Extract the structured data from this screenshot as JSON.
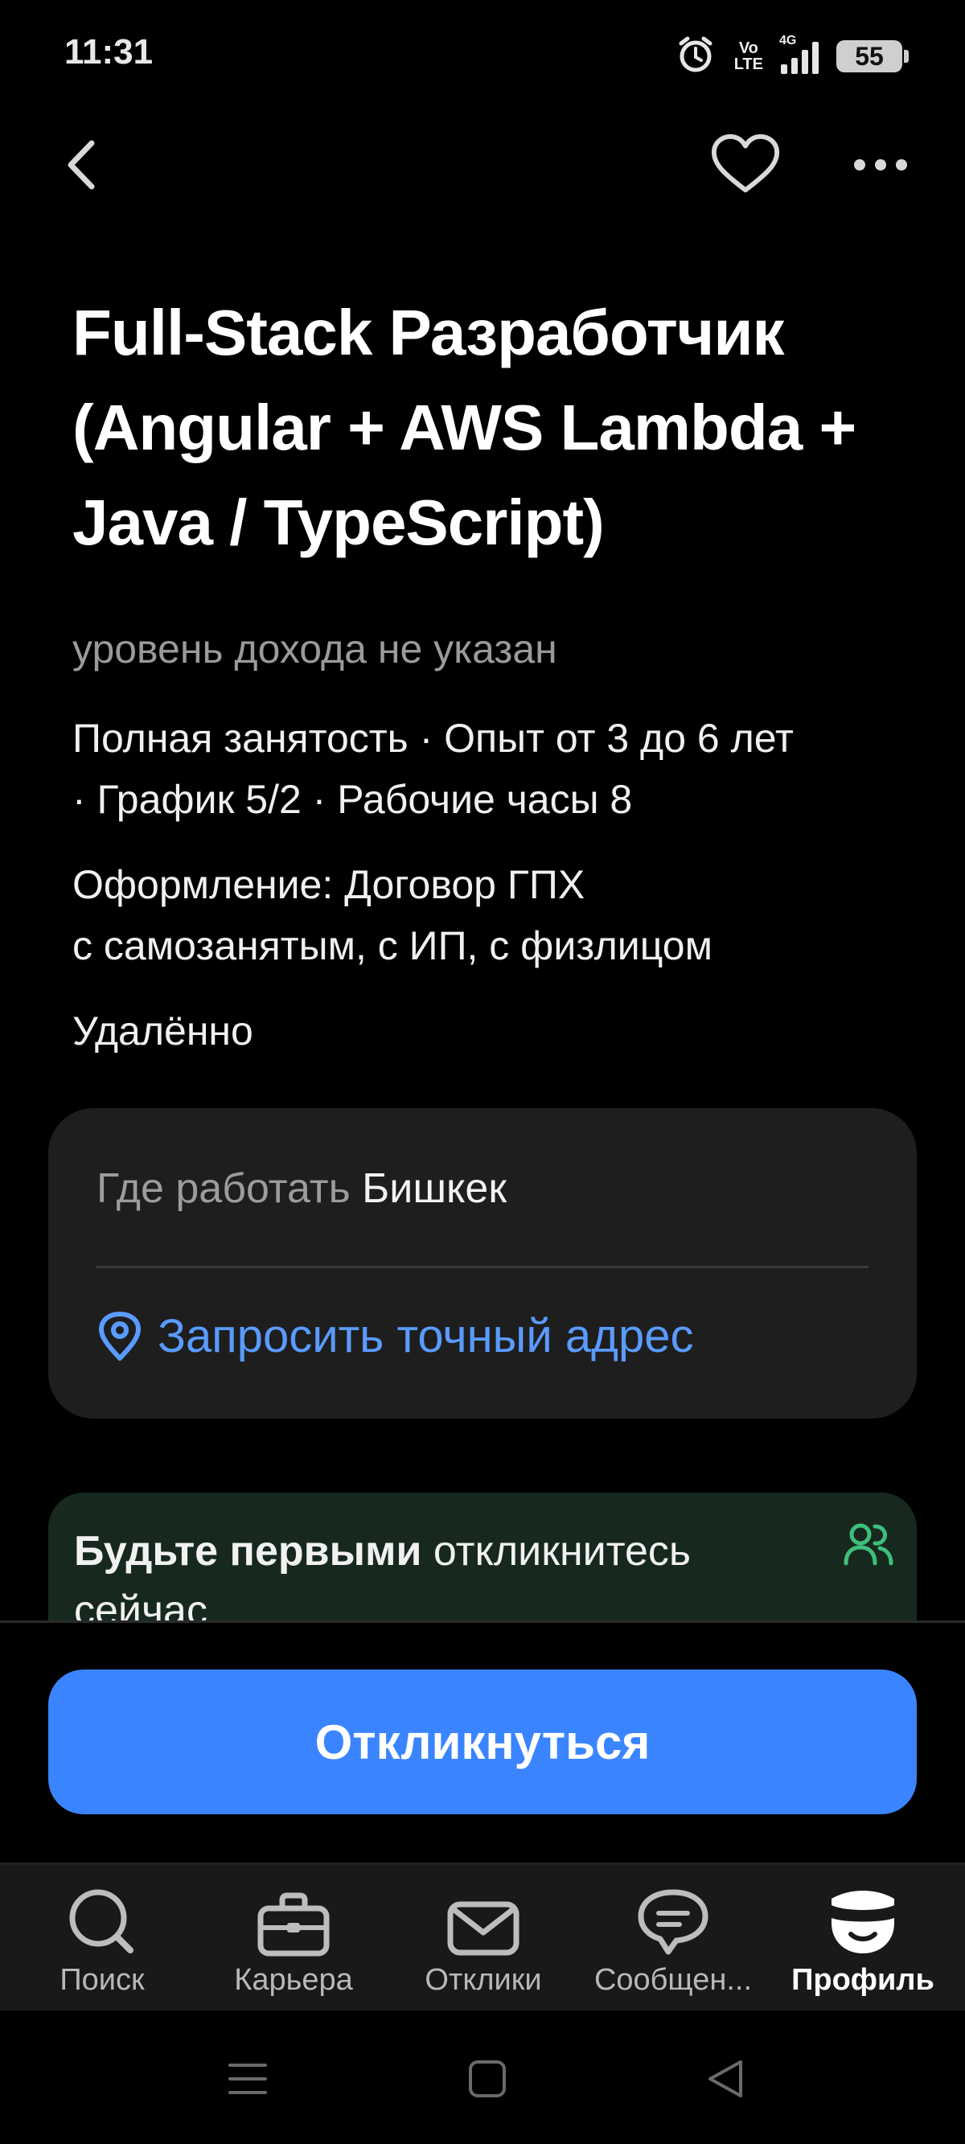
{
  "status_bar": {
    "time": "11:31",
    "network_top": "Vo",
    "network_bottom": "LTE",
    "network_type": "4G",
    "battery": "55"
  },
  "header": {
    "back_icon": "chevron-left-icon",
    "favorite_icon": "heart-icon",
    "more_icon": "more-horizontal-icon"
  },
  "vacancy": {
    "title": "Full-Stack Разработчик (Angular + AWS Lambda + Java / TypeScript)",
    "salary": "уровень дохода не указан",
    "conditions_line1": "Полная занятость · Опыт от 3 до 6 лет",
    "conditions_line2": "· График 5/2 · Рабочие часы 8",
    "contract_line1": "Оформление: Договор ГПХ",
    "contract_line2": "с самозанятым, с ИП, с физлицом",
    "work_format": "Удалённо"
  },
  "location": {
    "label": "Где работать",
    "city": "Бишкек",
    "address_link": "Запросить точный адрес"
  },
  "promo": {
    "bold": "Будьте первыми",
    "text": " откликнитесь сейчас"
  },
  "actions": {
    "apply": "Откликнуться"
  },
  "tabbar": {
    "items": [
      {
        "label": "Поиск",
        "icon": "search-icon"
      },
      {
        "label": "Карьера",
        "icon": "briefcase-icon"
      },
      {
        "label": "Отклики",
        "icon": "mail-icon"
      },
      {
        "label": "Сообщен...",
        "icon": "chat-icon"
      },
      {
        "label": "Профиль",
        "icon": "profile-icon"
      }
    ]
  },
  "colors": {
    "accent": "#3a85ff",
    "link": "#5a9bff",
    "promo_bg": "#17291f",
    "promo_icon": "#3ec07a",
    "card_bg": "#1e1e1e"
  }
}
